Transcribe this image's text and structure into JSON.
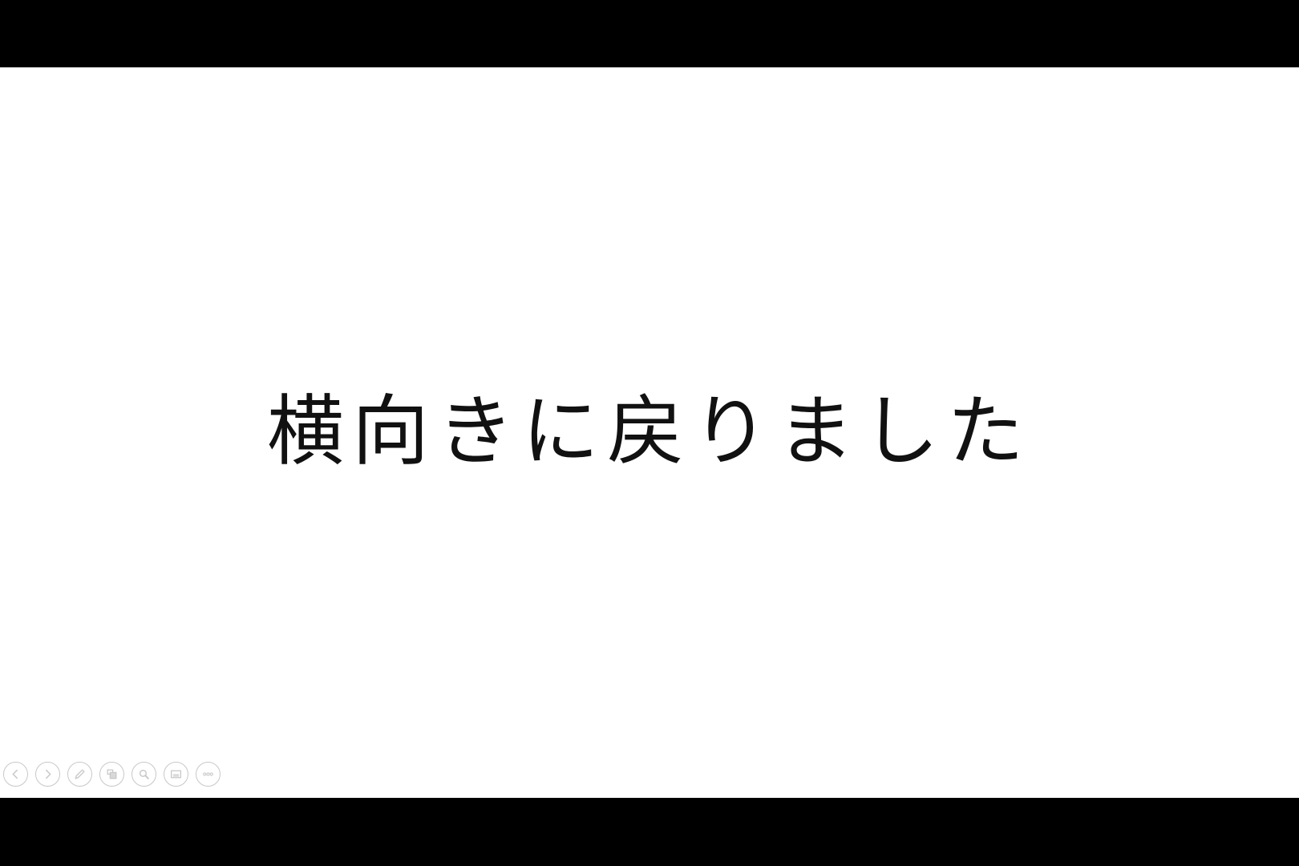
{
  "slide": {
    "text": "横向きに戻りました"
  },
  "controls": [
    {
      "icon": "previous-slide-icon"
    },
    {
      "icon": "next-slide-icon"
    },
    {
      "icon": "pen-icon"
    },
    {
      "icon": "slides-grid-icon"
    },
    {
      "icon": "zoom-icon"
    },
    {
      "icon": "subtitles-icon"
    },
    {
      "icon": "more-options-icon"
    }
  ],
  "colors": {
    "letterbox": "#000000",
    "slide_background": "#ffffff",
    "text": "#111111",
    "control_outline": "#c8c8c8"
  }
}
